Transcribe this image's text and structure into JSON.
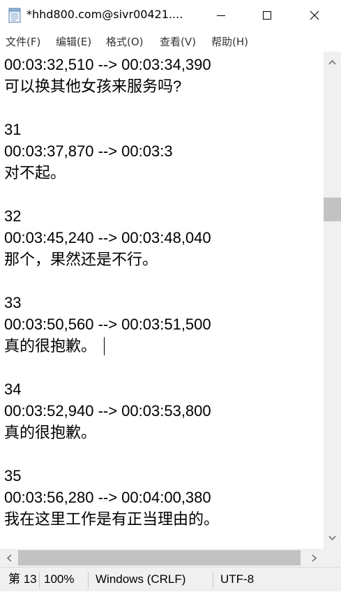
{
  "window": {
    "title": "*hhd800.com@sivr00421....",
    "minimize_label": "minimize",
    "maximize_label": "maximize",
    "close_label": "close"
  },
  "menu": [
    {
      "label": "文件(F)"
    },
    {
      "label": "编辑(E)"
    },
    {
      "label": "格式(O)"
    },
    {
      "label": "查看(V)"
    },
    {
      "label": "帮助(H)"
    }
  ],
  "editor": {
    "lines": [
      "00:03:32,510 --> 00:03:34,390",
      "可以换其他女孩来服务吗?",
      "",
      "31",
      "00:03:37,870 --> 00:03:3",
      "对不起。",
      "",
      "32",
      "00:03:45,240 --> 00:03:48,040",
      "那个，果然还是不行。",
      "",
      "33",
      "00:03:50,560 --> 00:03:51,500",
      "真的很抱歉。",
      "",
      "34",
      "00:03:52,940 --> 00:03:53,800",
      "真的很抱歉。",
      "",
      "35",
      "00:03:56,280 --> 00:04:00,380",
      "我在这里工作是有正当理由的。"
    ]
  },
  "scroll": {
    "vertical_position": 0.29
  },
  "status": {
    "position": "第 13",
    "zoom": "100%",
    "line_ending": "Windows (CRLF)",
    "encoding": "UTF-8"
  },
  "colors": {
    "scrollbar_track": "#f0f0f0",
    "scrollbar_thumb": "#c2c2c2",
    "menu_text": "#333333"
  }
}
